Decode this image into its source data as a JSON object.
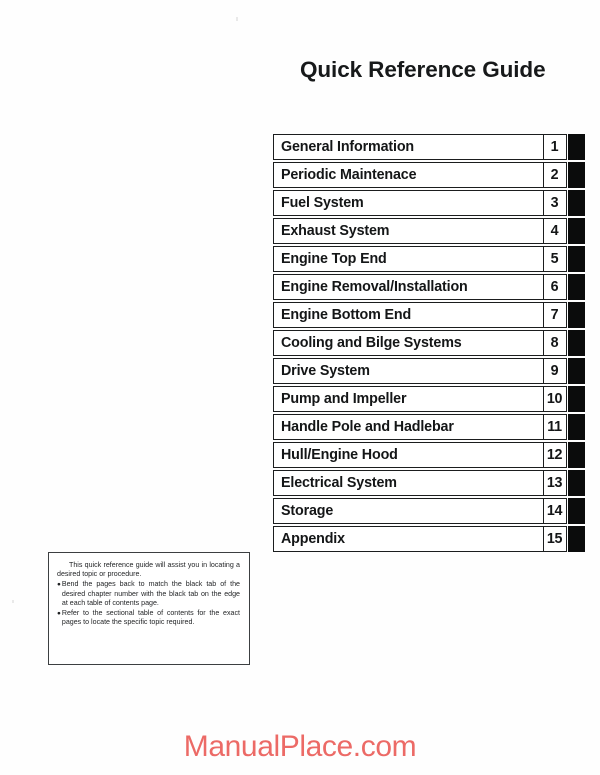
{
  "document": {
    "title": "Quick Reference Guide",
    "watermark": "ManualPlace.com"
  },
  "chapter_table": {
    "rows": [
      {
        "title": "General Information",
        "number": "1"
      },
      {
        "title": "Periodic Maintenace",
        "number": "2"
      },
      {
        "title": "Fuel System",
        "number": "3"
      },
      {
        "title": "Exhaust System",
        "number": "4"
      },
      {
        "title": "Engine Top End",
        "number": "5"
      },
      {
        "title": "Engine Removal/Installation",
        "number": "6"
      },
      {
        "title": "Engine Bottom End",
        "number": "7"
      },
      {
        "title": "Cooling and Bilge Systems",
        "number": "8"
      },
      {
        "title": "Drive System",
        "number": "9"
      },
      {
        "title": "Pump and Impeller",
        "number": "10"
      },
      {
        "title": "Handle Pole and Hadlebar",
        "number": "11"
      },
      {
        "title": "Hull/Engine Hood",
        "number": "12"
      },
      {
        "title": "Electrical System",
        "number": "13"
      },
      {
        "title": "Storage",
        "number": "14"
      },
      {
        "title": "Appendix",
        "number": "15"
      }
    ]
  },
  "note": {
    "intro": "This quick reference guide will assist you in locating a desired topic or procedure.",
    "bullet_marker": "●",
    "bullets": [
      "Bend the pages back to match the black tab of the desired chapter number with the black tab on the edge at each table of contents page.",
      "Refer to the sectional table of contents for the exact pages to locate the specific topic required."
    ]
  },
  "colors": {
    "ink": "#141617",
    "tab_black": "#0b0c0c",
    "watermark_red": "#ec6a66",
    "paper": "#fefefe"
  }
}
